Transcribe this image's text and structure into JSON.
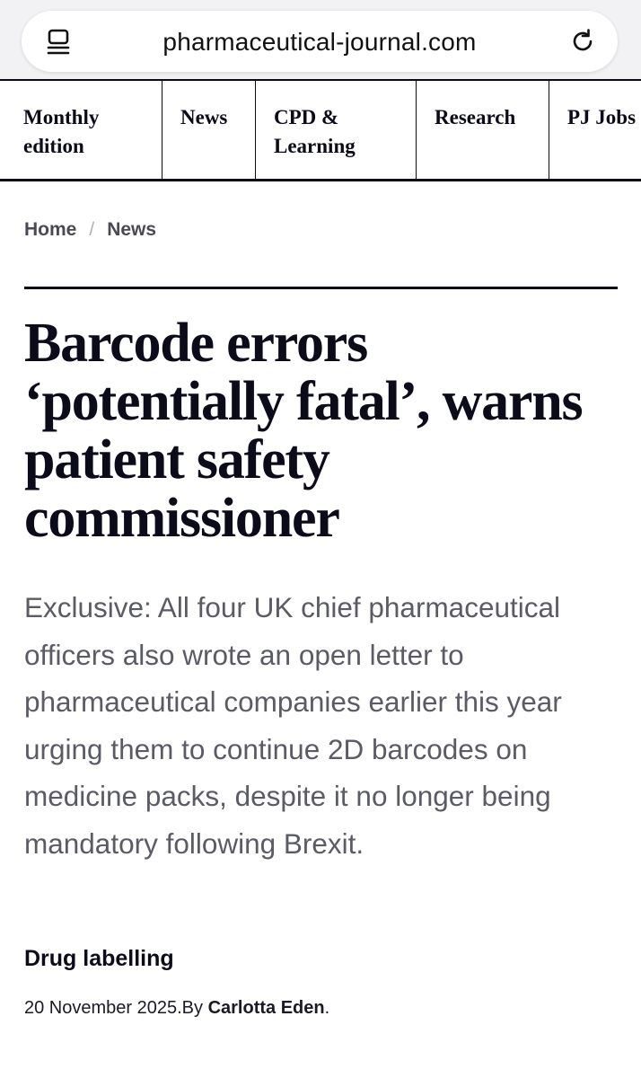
{
  "browser": {
    "url": "pharmaceutical-journal.com",
    "reader_icon": "reader-menu-icon",
    "reload_icon": "reload-icon"
  },
  "nav": {
    "items": [
      {
        "label": "Monthly edition"
      },
      {
        "label": "News"
      },
      {
        "label": "CPD & Learning"
      },
      {
        "label": "Research"
      },
      {
        "label": "PJ Jobs"
      }
    ]
  },
  "breadcrumb": {
    "home": "Home",
    "separator": "/",
    "current": "News"
  },
  "article": {
    "headline": "Barcode errors ‘potentially fatal’, warns patient safety commissioner",
    "standfirst": "Exclusive: All four UK chief pharmaceutical officers also wrote an open letter to pharmaceutical companies earlier this year urging them to continue 2D barcodes on medicine packs, despite it no longer being mandatory following Brexit.",
    "topic": "Drug labelling",
    "date": "20 November 2025.",
    "by_label": "By ",
    "author": "Carlotta Eden",
    "end_punct": "."
  },
  "colors": {
    "text_dark": "#0b0b1a",
    "standfirst_grey": "#5b5b66",
    "breadcrumb_grey": "#4a4a55",
    "browser_bg": "#f2f2f4"
  }
}
